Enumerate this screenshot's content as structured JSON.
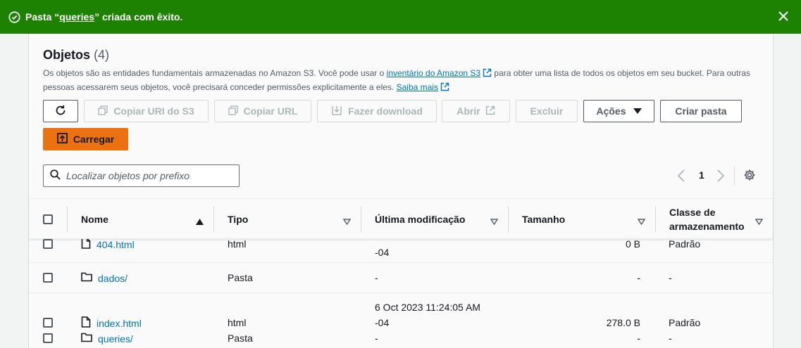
{
  "flash": {
    "prefix": "Pasta “",
    "folder": "queries",
    "suffix": "” criada com êxito."
  },
  "header": {
    "title": "Objetos",
    "count": "(4)",
    "desc_part1": "Os objetos são as entidades fundamentais armazenadas no Amazon S3. Você pode usar o ",
    "desc_link1": "inventário do Amazon S3",
    "desc_part2": " para obter uma lista de todos os objetos em seu bucket. Para outras pessoas acessarem seus objetos, você precisará conceder permissões explicitamente a eles. ",
    "desc_link2": "Saiba mais"
  },
  "toolbar": {
    "copy_uri": "Copiar URI do S3",
    "copy_url": "Copiar URL",
    "download": "Fazer download",
    "open": "Abrir",
    "delete": "Excluir",
    "actions": "Ações",
    "create_folder": "Criar pasta",
    "upload": "Carregar"
  },
  "search": {
    "placeholder": "Localizar objetos por prefixo"
  },
  "pagination": {
    "page": "1"
  },
  "table": {
    "columns": {
      "name": "Nome",
      "type": "Tipo",
      "modified": "Última modificação",
      "size": "Tamanho",
      "class_line1": "Classe de",
      "class_line2": "armazenamento"
    },
    "rows": [
      {
        "name": "404.html",
        "type": "html",
        "modified_l1": "",
        "modified_l2": "-04",
        "size": "0 B",
        "class": "Padrão"
      },
      {
        "name": "dados/",
        "type": "Pasta",
        "modified_l1": "-",
        "modified_l2": "",
        "size": "-",
        "class": "-"
      },
      {
        "name": "index.html",
        "type": "html",
        "modified_l1": "6 Oct 2023 11:24:05 AM",
        "modified_l2": "-04",
        "size": "278.0 B",
        "class": "Padrão"
      },
      {
        "name": "queries/",
        "type": "Pasta",
        "modified_l1": "-",
        "modified_l2": "",
        "size": "-",
        "class": "-"
      }
    ]
  }
}
